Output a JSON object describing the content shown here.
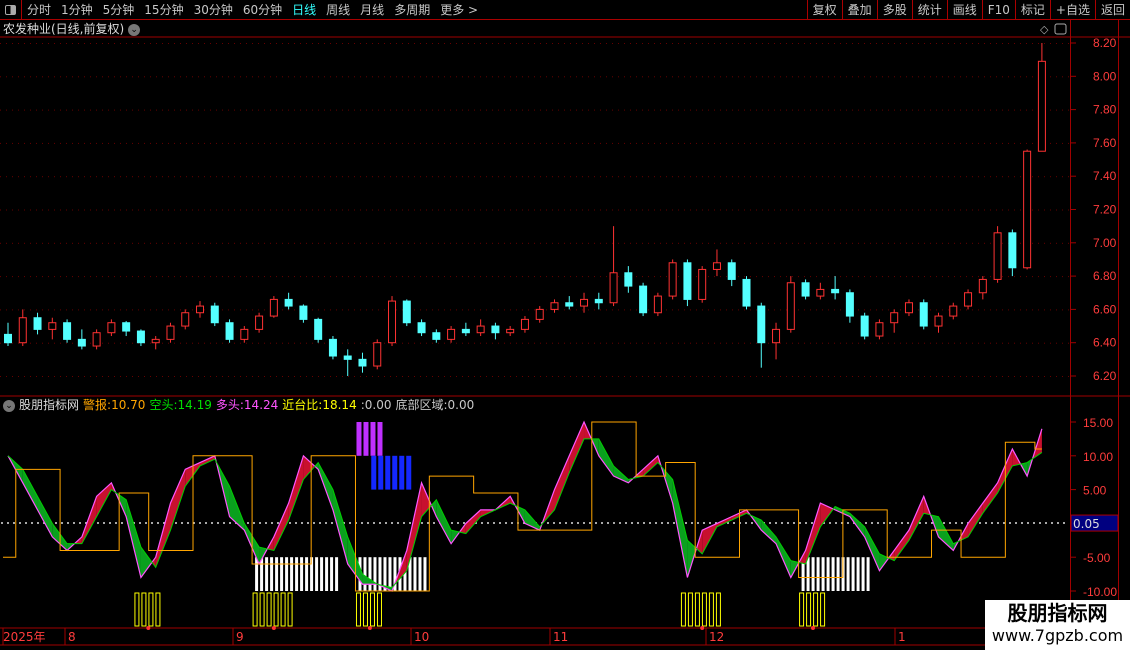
{
  "toolbar": {
    "periods": [
      "分时",
      "1分钟",
      "5分钟",
      "15分钟",
      "30分钟",
      "60分钟",
      "日线",
      "周线",
      "月线",
      "多周期",
      "更多 >"
    ],
    "active": "日线",
    "right_buttons": [
      "复权",
      "叠加",
      "多股",
      "统计",
      "画线",
      "F10",
      "标记",
      "+自选",
      "返回"
    ]
  },
  "main": {
    "title": "农发种业(日线,前复权)",
    "price_ticks": [
      "8.20",
      "8.00",
      "7.80",
      "7.60",
      "7.40",
      "7.20",
      "7.00",
      "6.80",
      "6.60",
      "6.40",
      "6.20"
    ]
  },
  "indicator": {
    "name": "股朋指标网",
    "fields": [
      {
        "label": "警报",
        "value": "10.70",
        "color": "#ffa500"
      },
      {
        "label": "空头",
        "value": "14.19",
        "color": "#00e000"
      },
      {
        "label": "多头",
        "value": "14.24",
        "color": "#ff55ff"
      },
      {
        "label": "近台比",
        "value": "18.14",
        "color": "#ffff00"
      },
      {
        "label": "",
        "value": "0.00",
        "color": "#c8c8c8"
      },
      {
        "label": "底部区域",
        "value": "0.00",
        "color": "#c8c8c8"
      }
    ],
    "ticks": [
      "15.00",
      "10.00",
      "5.00",
      "0.00",
      "-5.00",
      "-10.00"
    ],
    "current_value": "0.05"
  },
  "date_axis": [
    "2025年",
    "8",
    "9",
    "10",
    "11",
    "12",
    "1"
  ],
  "watermark": {
    "line1": "股朋指标网",
    "line2": "www.7gpzb.com"
  },
  "colors": {
    "up": "#ff3232",
    "down": "#54ffff",
    "grid": "#a00000"
  },
  "chart_data": [
    {
      "type": "candlestick",
      "ylim": [
        6.2,
        8.2
      ],
      "ohlc": [
        [
          6.45,
          6.52,
          6.38,
          6.4
        ],
        [
          6.4,
          6.6,
          6.38,
          6.55
        ],
        [
          6.55,
          6.58,
          6.45,
          6.48
        ],
        [
          6.48,
          6.55,
          6.42,
          6.52
        ],
        [
          6.52,
          6.54,
          6.4,
          6.42
        ],
        [
          6.42,
          6.48,
          6.36,
          6.38
        ],
        [
          6.38,
          6.48,
          6.36,
          6.46
        ],
        [
          6.46,
          6.54,
          6.44,
          6.52
        ],
        [
          6.52,
          6.53,
          6.44,
          6.47
        ],
        [
          6.47,
          6.48,
          6.38,
          6.4
        ],
        [
          6.4,
          6.44,
          6.36,
          6.42
        ],
        [
          6.42,
          6.52,
          6.4,
          6.5
        ],
        [
          6.5,
          6.6,
          6.48,
          6.58
        ],
        [
          6.58,
          6.65,
          6.55,
          6.62
        ],
        [
          6.62,
          6.64,
          6.5,
          6.52
        ],
        [
          6.52,
          6.54,
          6.4,
          6.42
        ],
        [
          6.42,
          6.5,
          6.4,
          6.48
        ],
        [
          6.48,
          6.58,
          6.46,
          6.56
        ],
        [
          6.56,
          6.68,
          6.55,
          6.66
        ],
        [
          6.66,
          6.7,
          6.6,
          6.62
        ],
        [
          6.62,
          6.63,
          6.52,
          6.54
        ],
        [
          6.54,
          6.55,
          6.4,
          6.42
        ],
        [
          6.42,
          6.44,
          6.3,
          6.32
        ],
        [
          6.32,
          6.36,
          6.2,
          6.3
        ],
        [
          6.3,
          6.34,
          6.22,
          6.26
        ],
        [
          6.26,
          6.42,
          6.24,
          6.4
        ],
        [
          6.4,
          6.68,
          6.38,
          6.65
        ],
        [
          6.65,
          6.66,
          6.5,
          6.52
        ],
        [
          6.52,
          6.54,
          6.44,
          6.46
        ],
        [
          6.46,
          6.48,
          6.4,
          6.42
        ],
        [
          6.42,
          6.5,
          6.4,
          6.48
        ],
        [
          6.48,
          6.52,
          6.44,
          6.46
        ],
        [
          6.46,
          6.54,
          6.44,
          6.5
        ],
        [
          6.5,
          6.52,
          6.42,
          6.46
        ],
        [
          6.46,
          6.5,
          6.44,
          6.48
        ],
        [
          6.48,
          6.56,
          6.46,
          6.54
        ],
        [
          6.54,
          6.62,
          6.52,
          6.6
        ],
        [
          6.6,
          6.66,
          6.58,
          6.64
        ],
        [
          6.64,
          6.68,
          6.6,
          6.62
        ],
        [
          6.62,
          6.7,
          6.58,
          6.66
        ],
        [
          6.66,
          6.7,
          6.6,
          6.64
        ],
        [
          6.64,
          7.1,
          6.62,
          6.82
        ],
        [
          6.82,
          6.86,
          6.7,
          6.74
        ],
        [
          6.74,
          6.76,
          6.56,
          6.58
        ],
        [
          6.58,
          6.7,
          6.56,
          6.68
        ],
        [
          6.68,
          6.9,
          6.66,
          6.88
        ],
        [
          6.88,
          6.9,
          6.62,
          6.66
        ],
        [
          6.66,
          6.86,
          6.64,
          6.84
        ],
        [
          6.84,
          6.96,
          6.8,
          6.88
        ],
        [
          6.88,
          6.9,
          6.74,
          6.78
        ],
        [
          6.78,
          6.8,
          6.6,
          6.62
        ],
        [
          6.62,
          6.64,
          6.25,
          6.4
        ],
        [
          6.4,
          6.52,
          6.3,
          6.48
        ],
        [
          6.48,
          6.8,
          6.46,
          6.76
        ],
        [
          6.76,
          6.78,
          6.66,
          6.68
        ],
        [
          6.68,
          6.76,
          6.66,
          6.72
        ],
        [
          6.72,
          6.8,
          6.66,
          6.7
        ],
        [
          6.7,
          6.72,
          6.52,
          6.56
        ],
        [
          6.56,
          6.58,
          6.42,
          6.44
        ],
        [
          6.44,
          6.54,
          6.42,
          6.52
        ],
        [
          6.52,
          6.6,
          6.46,
          6.58
        ],
        [
          6.58,
          6.66,
          6.56,
          6.64
        ],
        [
          6.64,
          6.66,
          6.48,
          6.5
        ],
        [
          6.5,
          6.58,
          6.46,
          6.56
        ],
        [
          6.56,
          6.64,
          6.54,
          6.62
        ],
        [
          6.62,
          6.72,
          6.6,
          6.7
        ],
        [
          6.7,
          6.8,
          6.66,
          6.78
        ],
        [
          6.78,
          7.1,
          6.76,
          7.06
        ],
        [
          7.06,
          7.08,
          6.8,
          6.85
        ],
        [
          6.85,
          7.56,
          6.84,
          7.55
        ],
        [
          7.55,
          8.2,
          7.55,
          8.09
        ]
      ]
    },
    {
      "type": "line",
      "ylim": [
        -10,
        15
      ],
      "bull": [
        10,
        6,
        2,
        -2,
        -4,
        -2,
        4,
        6,
        1,
        -8,
        -5,
        3,
        8,
        9,
        10,
        1,
        -1,
        -6,
        -2,
        3,
        10,
        8,
        2,
        -6,
        -9,
        -9,
        -10,
        -4,
        6,
        1,
        -3,
        0,
        2,
        2,
        4,
        0,
        -1,
        5,
        10,
        15,
        10,
        7,
        6,
        8,
        10,
        3,
        -8,
        -1,
        0,
        1,
        2,
        -1,
        -3,
        -8,
        -4,
        3,
        2,
        1,
        -2,
        -7,
        -4,
        -1,
        4,
        -2,
        -4,
        0,
        3,
        6,
        11,
        7,
        14
      ],
      "bear": [
        10,
        8,
        4,
        0,
        -3,
        -3,
        1,
        5,
        3.5,
        -3.5,
        -6.5,
        -1,
        5.5,
        8.5,
        9.5,
        5.5,
        0,
        -3.5,
        -4,
        0.5,
        6.5,
        9,
        5,
        -2,
        -7.5,
        -9,
        -9.5,
        -7,
        1,
        3.5,
        -1,
        -1.5,
        1,
        2,
        3,
        2,
        -0.5,
        2,
        7.5,
        12.5,
        12.5,
        8.5,
        6.5,
        7,
        9,
        6.5,
        -2.5,
        -4.5,
        -0.5,
        0.5,
        1.5,
        0.5,
        -2,
        -5.5,
        -6,
        -0.5,
        2.5,
        1.5,
        -0.5,
        -4.5,
        -5.5,
        -2.5,
        1.5,
        1,
        -3,
        -2,
        1.5,
        4.5,
        8.5,
        9,
        10.5
      ],
      "step": [
        -5,
        8,
        8,
        8,
        -4,
        -4,
        -4,
        -4,
        4.5,
        4.5,
        -4,
        -4,
        -4,
        10,
        10,
        10,
        10,
        -6,
        -6,
        -6,
        -6,
        10,
        10,
        10,
        -10,
        -10,
        -10,
        -10,
        -10,
        7,
        7,
        7,
        4.5,
        4.5,
        4.5,
        -1,
        -1,
        -1,
        -1,
        -1,
        15,
        15,
        15,
        7,
        7,
        9,
        9,
        -5,
        -5,
        -5,
        2,
        2,
        2,
        2,
        -8,
        -8,
        -8,
        2,
        2,
        2,
        -5,
        -5,
        -5,
        -1,
        -1,
        -5,
        -5,
        -5,
        12,
        12,
        11
      ],
      "bottom_zones": [
        [
          17,
          22
        ],
        [
          24,
          28
        ],
        [
          54,
          58
        ]
      ],
      "markers": [
        [
          9,
          10
        ],
        [
          17,
          19
        ],
        [
          24,
          25
        ],
        [
          46,
          48
        ],
        [
          54,
          55
        ]
      ],
      "magenta_bars": {
        "range": [
          24,
          25
        ],
        "values": [
          10,
          15
        ]
      },
      "blue_bars": {
        "range": [
          25,
          27
        ],
        "values": [
          5,
          10
        ]
      }
    }
  ]
}
